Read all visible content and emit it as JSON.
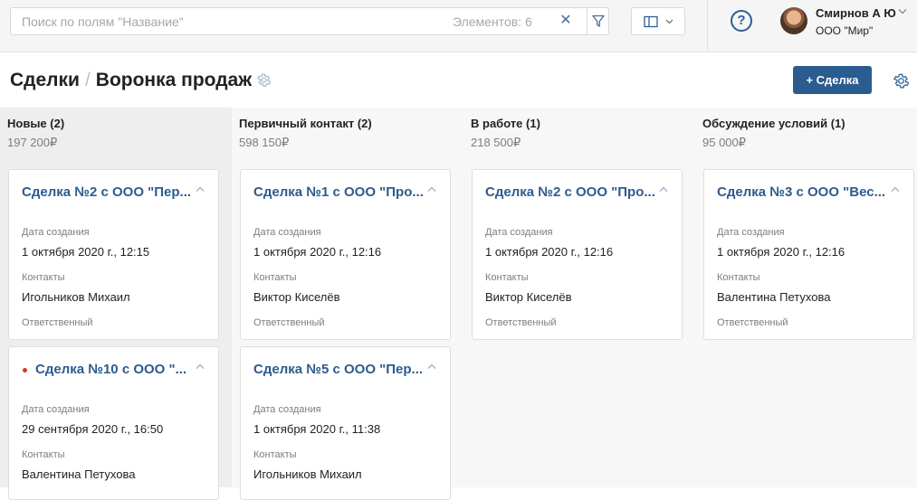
{
  "search": {
    "placeholder": "Поиск по полям \"Название\"",
    "value": "",
    "count_label": "Элементов: 6"
  },
  "user": {
    "name": "Смирнов А Ю",
    "company": "ООО \"Мир\""
  },
  "breadcrumb": {
    "root": "Сделки",
    "current": "Воронка продаж"
  },
  "add_button": "+ Сделка",
  "field_labels": {
    "created": "Дата создания",
    "contacts": "Контакты",
    "responsible": "Ответственный"
  },
  "columns": [
    {
      "title": "Новые (2)",
      "sum": "197 200₽",
      "cards": [
        {
          "title": "Сделка №2 с ООО \"Пер...",
          "created": "1 октября 2020 г., 12:15",
          "contact": "Игольников Михаил",
          "flag": false
        },
        {
          "title": "Сделка №10 с ООО \"...",
          "created": "29 сентября 2020 г., 16:50",
          "contact": "Валентина Петухова",
          "flag": true
        }
      ]
    },
    {
      "title": "Первичный контакт (2)",
      "sum": "598 150₽",
      "cards": [
        {
          "title": "Сделка №1 с ООО \"Про...",
          "created": "1 октября 2020 г., 12:16",
          "contact": "Виктор Киселёв",
          "flag": false
        },
        {
          "title": "Сделка №5 с ООО \"Пер...",
          "created": "1 октября 2020 г., 11:38",
          "contact": "Игольников Михаил",
          "flag": false
        }
      ]
    },
    {
      "title": "В работе (1)",
      "sum": "218 500₽",
      "cards": [
        {
          "title": "Сделка №2 с ООО \"Про...",
          "created": "1 октября 2020 г., 12:16",
          "contact": "Виктор Киселёв",
          "flag": false
        }
      ]
    },
    {
      "title": "Обсуждение условий (1)",
      "sum": "95 000₽",
      "cards": [
        {
          "title": "Сделка №3 с ООО \"Вес...",
          "created": "1 октября 2020 г., 12:16",
          "contact": "Валентина Петухова",
          "flag": false
        }
      ]
    }
  ],
  "colors": {
    "accent": "#2a5c8f",
    "link": "#2d5b8f",
    "flag": "#d9381e"
  }
}
